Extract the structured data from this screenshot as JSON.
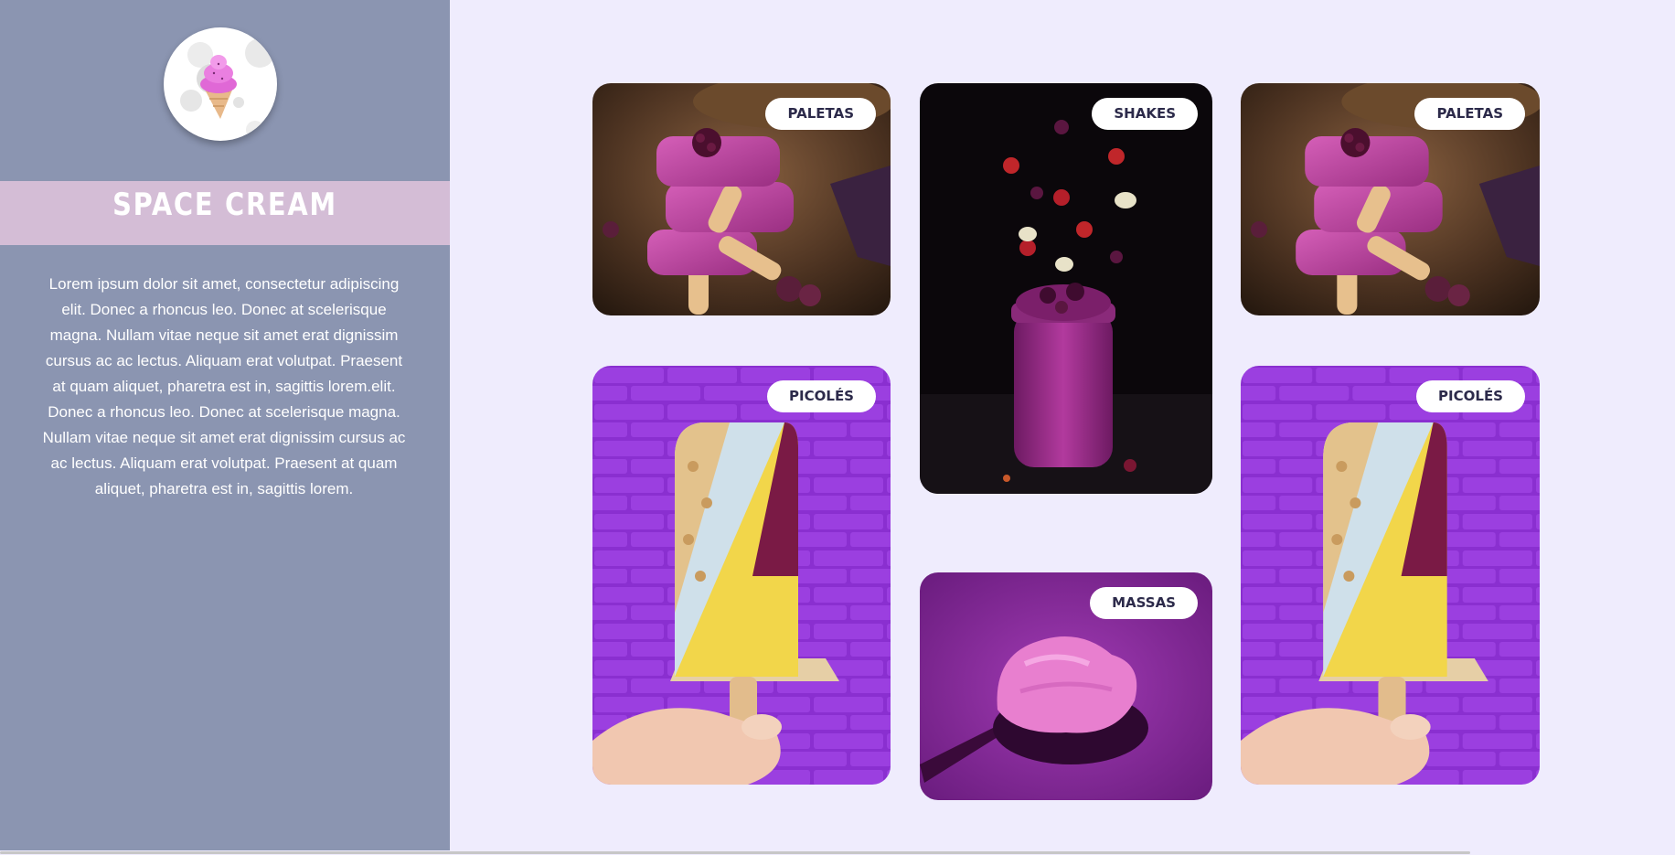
{
  "brand": {
    "name": "SPACE CREAM",
    "logo_icon": "ice-cream-cone-icon"
  },
  "about": {
    "text": "Lorem ipsum dolor sit amet, consectetur adipiscing elit. Donec a rhoncus leo. Donec at scelerisque magna. Nullam vitae neque sit amet erat dignissim cursus ac ac lectus. Aliquam erat volutpat. Praesent at quam aliquet, pharetra est in, sagittis lorem.elit. Donec a rhoncus leo. Donec at scelerisque magna. Nullam vitae neque sit amet erat dignissim cursus ac ac lectus. Aliquam erat volutpat. Praesent at quam aliquet, pharetra est in, sagittis lorem."
  },
  "gallery": {
    "cards": [
      {
        "label": "PALETAS",
        "image": "stacked-berry-popsicles-photo"
      },
      {
        "label": "SHAKES",
        "image": "berry-shake-jar-photo"
      },
      {
        "label": "PALETAS",
        "image": "stacked-berry-popsicles-photo"
      },
      {
        "label": "PICOLÉS",
        "image": "dipped-popsicle-brick-wall-photo"
      },
      {
        "label": "MASSAS",
        "image": "ice-cream-scoop-photo"
      },
      {
        "label": "PICOLÉS",
        "image": "dipped-popsicle-brick-wall-photo"
      }
    ]
  },
  "colors": {
    "sidebar": "#8b95b1",
    "title_band": "#d4bdd6",
    "page_background": "#efecfd",
    "badge_text": "#2c2a4a"
  }
}
